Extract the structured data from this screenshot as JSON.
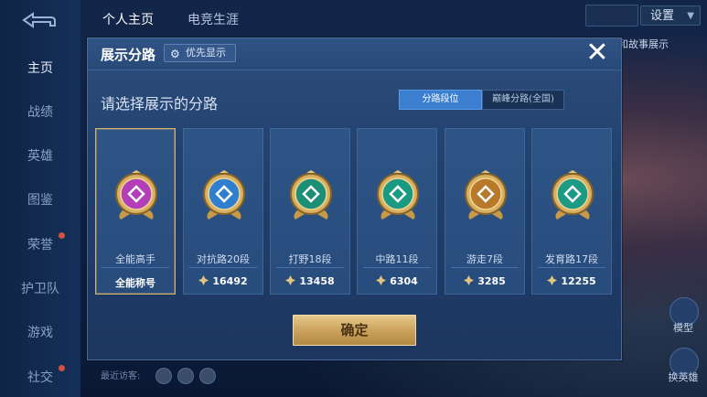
{
  "background": {
    "left_nav": [
      {
        "label": "主页",
        "active": true
      },
      {
        "label": "战绩",
        "active": false
      },
      {
        "label": "英雄",
        "active": false
      },
      {
        "label": "图鉴",
        "active": false
      },
      {
        "label": "荣誉",
        "active": false
      },
      {
        "label": "护卫队",
        "active": false
      },
      {
        "label": "游戏",
        "active": false
      },
      {
        "label": "社交",
        "active": false
      }
    ],
    "top_tabs": [
      "个人主页",
      "电竞生涯"
    ],
    "settings_label": "设置",
    "right_text": "和故事展示",
    "bottom_text": "最近访客:",
    "right_labels": [
      "模型",
      "换英雄"
    ]
  },
  "modal": {
    "title": "展示分路",
    "priority_label": "优先显示",
    "close_symbol": "✕",
    "subtitle": "请选择展示的分路",
    "segments": [
      "分路段位",
      "巅峰分路(全国)"
    ],
    "active_segment": 0,
    "cards": [
      {
        "name": "全能高手",
        "score": "全能称号",
        "show_icon": false,
        "selected": true,
        "emblem": "allround-emblem-icon",
        "color": "#b23fb8"
      },
      {
        "name": "对抗路20段",
        "score": "16492",
        "show_icon": true,
        "selected": false,
        "emblem": "clash-lane-emblem-icon",
        "color": "#2f7fd0"
      },
      {
        "name": "打野18段",
        "score": "13458",
        "show_icon": true,
        "selected": false,
        "emblem": "jungle-emblem-icon",
        "color": "#1c8f76"
      },
      {
        "name": "中路11段",
        "score": "6304",
        "show_icon": true,
        "selected": false,
        "emblem": "mid-lane-emblem-icon",
        "color": "#1a9a82"
      },
      {
        "name": "游走7段",
        "score": "3285",
        "show_icon": true,
        "selected": false,
        "emblem": "roam-emblem-icon",
        "color": "#b8792b"
      },
      {
        "name": "发育路17段",
        "score": "12255",
        "show_icon": true,
        "selected": false,
        "emblem": "farm-lane-emblem-icon",
        "color": "#1c9a84"
      }
    ],
    "confirm_label": "确定"
  }
}
